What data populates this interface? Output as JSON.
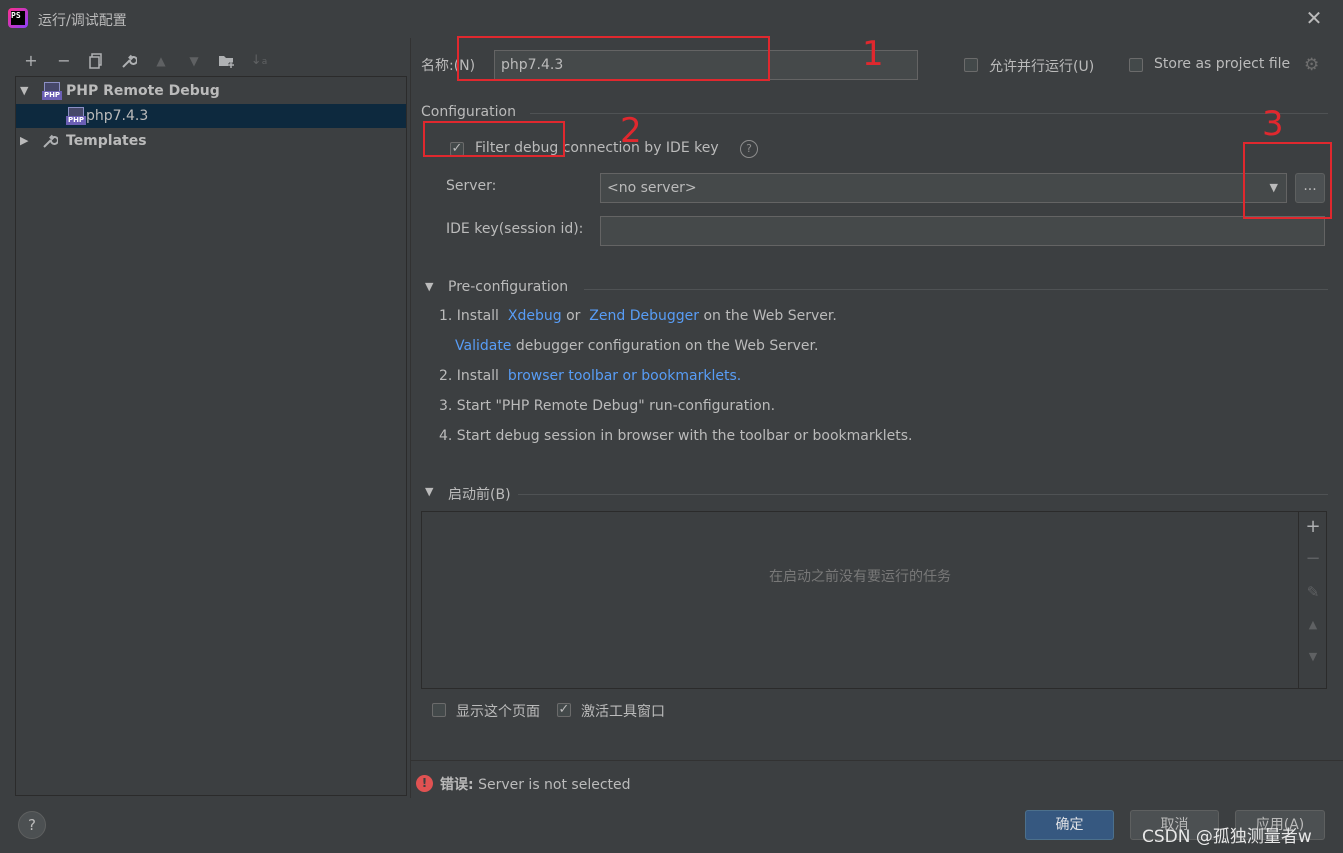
{
  "window": {
    "title": "运行/调试配置",
    "app_badge": "PS"
  },
  "toolbar": {
    "add": "+",
    "remove": "−",
    "copy": "⧉",
    "wrench": "🔧",
    "up": "▲",
    "down": "▼",
    "folder": "📁",
    "sort": "↓a"
  },
  "tree": {
    "group": "PHP Remote Debug",
    "item": "php7.4.3",
    "templates": "Templates",
    "icon_label": "PHP"
  },
  "form": {
    "name_label": "名称:(N)",
    "name_value": "php7.4.3",
    "parallel_label": "允许并行运行(U)",
    "store_label": "Store as project file",
    "configuration_header": "Configuration",
    "filter_label": "Filter debug connection by IDE key",
    "server_label": "Server:",
    "server_value": "<no server>",
    "ellipsis": "...",
    "idekey_label": "IDE key(session id):",
    "idekey_value": ""
  },
  "preconfig": {
    "header": "Pre-configuration",
    "step1_prefix": "1. Install",
    "xdebug": "Xdebug",
    "or": "or",
    "zend": "Zend Debugger",
    "step1_suffix": "on the Web Server.",
    "validate": "Validate",
    "validate_suffix": "debugger configuration on the Web Server.",
    "step2_prefix": "2. Install",
    "browser_toolbar": "browser toolbar or bookmarklets.",
    "step3": "3. Start \"PHP Remote Debug\" run-configuration.",
    "step4": "4. Start debug session in browser with the toolbar or bookmarklets."
  },
  "before_launch": {
    "header": "启动前(B)",
    "empty": "在启动之前没有要运行的任务"
  },
  "options": {
    "show_page": "显示这个页面",
    "activate_tool": "激活工具窗口"
  },
  "error": {
    "prefix": "错误:",
    "message": "Server is not selected"
  },
  "buttons": {
    "ok": "确定",
    "cancel": "取消",
    "apply": "应用(A)",
    "help": "?"
  },
  "annotations": {
    "one": "1",
    "two": "2",
    "three": "3"
  },
  "watermark": "CSDN @孤独测量者w",
  "colors": {
    "background": "#3c3f41",
    "accent": "#365880",
    "link": "#589df6",
    "annotation": "#e0282e",
    "error": "#e05252"
  }
}
